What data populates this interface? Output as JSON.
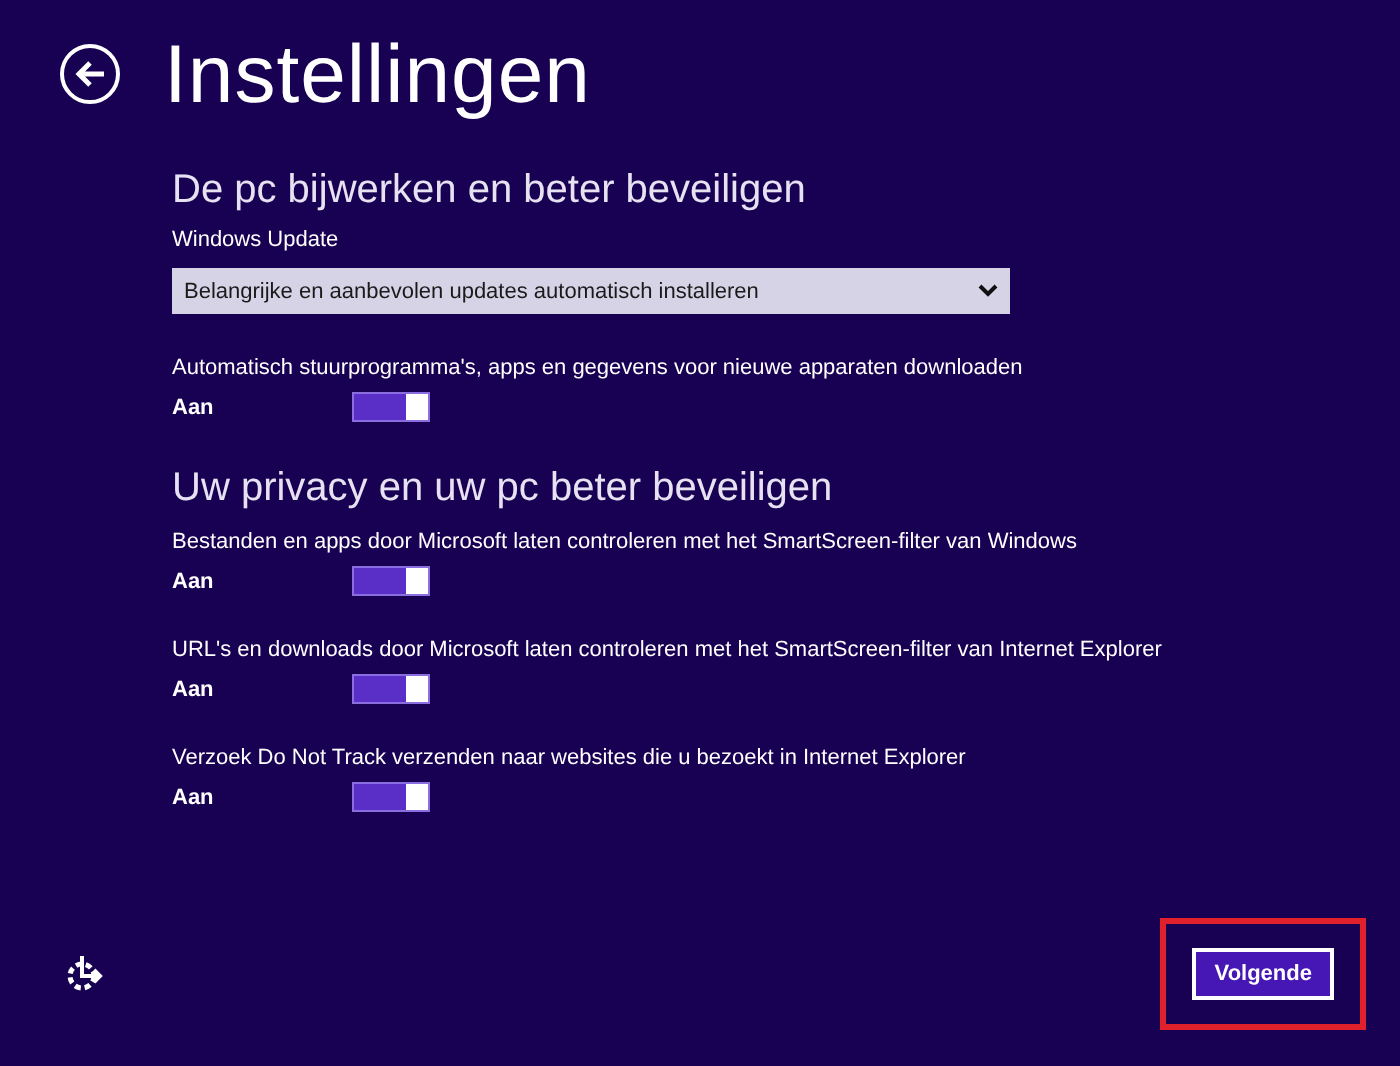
{
  "header": {
    "title": "Instellingen"
  },
  "sections": [
    {
      "heading": "De pc bijwerken en beter beveiligen",
      "dropdown": {
        "label": "Windows Update",
        "value": "Belangrijke en aanbevolen updates automatisch installeren"
      },
      "settings": [
        {
          "label": "Automatisch stuurprogramma's, apps en gegevens voor nieuwe apparaten downloaden",
          "state_text": "Aan",
          "on": true
        }
      ]
    },
    {
      "heading": "Uw privacy en uw pc beter beveiligen",
      "settings": [
        {
          "label": "Bestanden en apps door Microsoft laten controleren met het SmartScreen-filter van Windows",
          "state_text": "Aan",
          "on": true
        },
        {
          "label": "URL's en downloads door Microsoft laten controleren met het SmartScreen-filter van Internet Explorer",
          "state_text": "Aan",
          "on": true
        },
        {
          "label": "Verzoek Do Not Track verzenden naar websites die u bezoekt in Internet Explorer",
          "state_text": "Aan",
          "on": true
        }
      ]
    }
  ],
  "footer": {
    "next_button": {
      "label": "Volgende",
      "highlighted": true
    }
  }
}
